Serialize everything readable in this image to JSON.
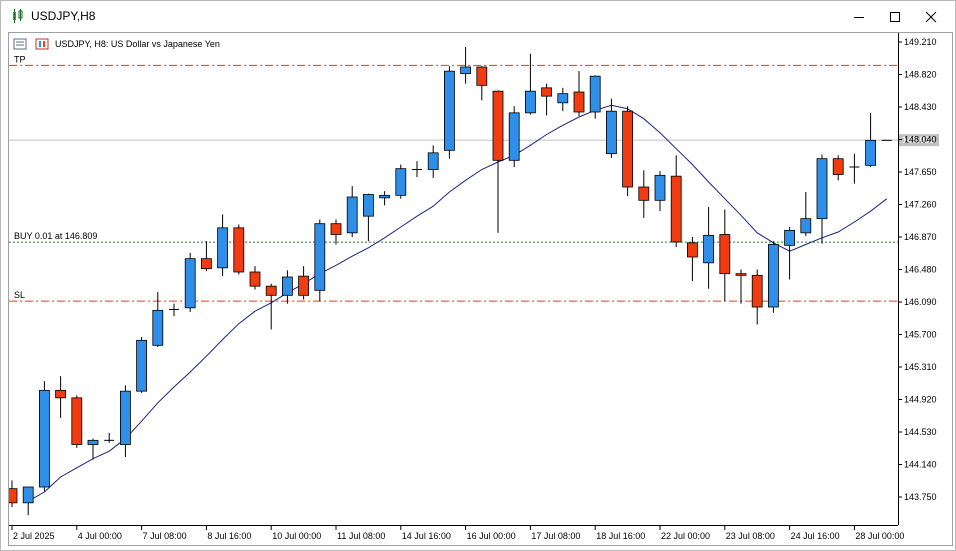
{
  "window": {
    "title": "USDJPY,H8"
  },
  "chart_header": {
    "symbol_label": "USDJPY, H8:  US Dollar vs Japanese Yen"
  },
  "colors": {
    "bull": "#2f8fe8",
    "bear": "#f03c10",
    "wick": "#000000",
    "ma": "#1a237e",
    "sltp_line": "#f03c10",
    "order_line": "#2e7d32",
    "price_line": "#c0c0c0",
    "grid": "#ffffff"
  },
  "chart_data": {
    "type": "candlestick",
    "symbol": "USDJPY",
    "timeframe": "H8",
    "ylim": [
      143.3,
      149.4
    ],
    "y_ticks": [
      "149.210",
      "148.820",
      "148.430",
      "148.040",
      "147.650",
      "147.260",
      "146.870",
      "146.480",
      "146.090",
      "145.700",
      "145.310",
      "144.920",
      "144.530",
      "144.140",
      "143.750"
    ],
    "x_ticks": [
      {
        "index": 0,
        "label": "2 Jul 2025"
      },
      {
        "index": 4,
        "label": "4 Jul 00:00"
      },
      {
        "index": 8,
        "label": "7 Jul 08:00"
      },
      {
        "index": 12,
        "label": "8 Jul 16:00"
      },
      {
        "index": 16,
        "label": "10 Jul 00:00"
      },
      {
        "index": 20,
        "label": "11 Jul 08:00"
      },
      {
        "index": 24,
        "label": "14 Jul 16:00"
      },
      {
        "index": 28,
        "label": "16 Jul 00:00"
      },
      {
        "index": 32,
        "label": "17 Jul 08:00"
      },
      {
        "index": 36,
        "label": "18 Jul 16:00"
      },
      {
        "index": 40,
        "label": "22 Jul 00:00"
      },
      {
        "index": 44,
        "label": "23 Jul 08:00"
      },
      {
        "index": 48,
        "label": "24 Jul 16:00"
      },
      {
        "index": 52,
        "label": "28 Jul 00:00"
      }
    ],
    "candles": [
      {
        "o": 143.85,
        "h": 143.95,
        "l": 143.63,
        "c": 143.68
      },
      {
        "o": 143.68,
        "h": 143.87,
        "l": 143.53,
        "c": 143.87
      },
      {
        "o": 143.87,
        "h": 145.14,
        "l": 143.82,
        "c": 145.03
      },
      {
        "o": 145.03,
        "h": 145.2,
        "l": 144.7,
        "c": 144.94
      },
      {
        "o": 144.94,
        "h": 144.97,
        "l": 144.34,
        "c": 144.38
      },
      {
        "o": 144.38,
        "h": 144.45,
        "l": 144.2,
        "c": 144.43
      },
      {
        "o": 144.43,
        "h": 144.52,
        "l": 144.4,
        "c": 144.43
      },
      {
        "o": 144.38,
        "h": 145.09,
        "l": 144.23,
        "c": 145.02
      },
      {
        "o": 145.02,
        "h": 145.67,
        "l": 145.0,
        "c": 145.63
      },
      {
        "o": 145.57,
        "h": 146.21,
        "l": 145.55,
        "c": 145.99
      },
      {
        "o": 145.99,
        "h": 146.07,
        "l": 145.92,
        "c": 146.0
      },
      {
        "o": 146.02,
        "h": 146.68,
        "l": 145.97,
        "c": 146.61
      },
      {
        "o": 146.61,
        "h": 146.82,
        "l": 146.46,
        "c": 146.49
      },
      {
        "o": 146.5,
        "h": 147.14,
        "l": 146.4,
        "c": 146.98
      },
      {
        "o": 146.98,
        "h": 147.02,
        "l": 146.42,
        "c": 146.45
      },
      {
        "o": 146.45,
        "h": 146.52,
        "l": 146.24,
        "c": 146.28
      },
      {
        "o": 146.28,
        "h": 146.31,
        "l": 145.76,
        "c": 146.17
      },
      {
        "o": 146.17,
        "h": 146.47,
        "l": 146.07,
        "c": 146.39
      },
      {
        "o": 146.4,
        "h": 146.52,
        "l": 146.12,
        "c": 146.17
      },
      {
        "o": 146.23,
        "h": 147.08,
        "l": 146.1,
        "c": 147.03
      },
      {
        "o": 147.03,
        "h": 147.08,
        "l": 146.78,
        "c": 146.9
      },
      {
        "o": 146.92,
        "h": 147.48,
        "l": 146.87,
        "c": 147.35
      },
      {
        "o": 147.12,
        "h": 147.39,
        "l": 146.82,
        "c": 147.38
      },
      {
        "o": 147.34,
        "h": 147.42,
        "l": 147.25,
        "c": 147.37
      },
      {
        "o": 147.37,
        "h": 147.74,
        "l": 147.33,
        "c": 147.69
      },
      {
        "o": 147.68,
        "h": 147.78,
        "l": 147.59,
        "c": 147.68
      },
      {
        "o": 147.68,
        "h": 147.97,
        "l": 147.58,
        "c": 147.88
      },
      {
        "o": 147.91,
        "h": 148.92,
        "l": 147.81,
        "c": 148.86
      },
      {
        "o": 148.83,
        "h": 149.15,
        "l": 148.71,
        "c": 148.91
      },
      {
        "o": 148.91,
        "h": 148.92,
        "l": 148.51,
        "c": 148.69
      },
      {
        "o": 148.62,
        "h": 148.63,
        "l": 146.92,
        "c": 147.79
      },
      {
        "o": 147.79,
        "h": 148.44,
        "l": 147.71,
        "c": 148.36
      },
      {
        "o": 148.36,
        "h": 149.07,
        "l": 148.34,
        "c": 148.62
      },
      {
        "o": 148.66,
        "h": 148.71,
        "l": 148.33,
        "c": 148.56
      },
      {
        "o": 148.48,
        "h": 148.66,
        "l": 148.38,
        "c": 148.59
      },
      {
        "o": 148.61,
        "h": 148.86,
        "l": 148.32,
        "c": 148.37
      },
      {
        "o": 148.37,
        "h": 148.81,
        "l": 148.29,
        "c": 148.8
      },
      {
        "o": 147.87,
        "h": 148.53,
        "l": 147.82,
        "c": 148.38
      },
      {
        "o": 148.38,
        "h": 148.44,
        "l": 147.36,
        "c": 147.47
      },
      {
        "o": 147.47,
        "h": 147.67,
        "l": 147.1,
        "c": 147.31
      },
      {
        "o": 147.31,
        "h": 147.66,
        "l": 147.18,
        "c": 147.61
      },
      {
        "o": 147.6,
        "h": 147.85,
        "l": 146.75,
        "c": 146.81
      },
      {
        "o": 146.8,
        "h": 146.87,
        "l": 146.34,
        "c": 146.63
      },
      {
        "o": 146.56,
        "h": 147.23,
        "l": 146.25,
        "c": 146.89
      },
      {
        "o": 146.9,
        "h": 147.2,
        "l": 146.1,
        "c": 146.43
      },
      {
        "o": 146.43,
        "h": 146.48,
        "l": 146.07,
        "c": 146.41
      },
      {
        "o": 146.41,
        "h": 146.48,
        "l": 145.82,
        "c": 146.03
      },
      {
        "o": 146.03,
        "h": 146.82,
        "l": 145.96,
        "c": 146.78
      },
      {
        "o": 146.77,
        "h": 146.99,
        "l": 146.36,
        "c": 146.95
      },
      {
        "o": 146.92,
        "h": 147.41,
        "l": 146.88,
        "c": 147.09
      },
      {
        "o": 147.09,
        "h": 147.86,
        "l": 146.79,
        "c": 147.81
      },
      {
        "o": 147.81,
        "h": 147.85,
        "l": 147.55,
        "c": 147.62
      },
      {
        "o": 147.71,
        "h": 147.87,
        "l": 147.51,
        "c": 147.71
      },
      {
        "o": 147.73,
        "h": 148.36,
        "l": 147.71,
        "c": 148.03
      },
      {
        "o": 148.03,
        "h": 148.03,
        "l": 148.03,
        "c": 148.03
      }
    ],
    "moving_average": [
      null,
      143.7,
      143.81,
      143.99,
      144.1,
      144.21,
      144.3,
      144.45,
      144.66,
      144.88,
      145.07,
      145.25,
      145.44,
      145.64,
      145.83,
      145.98,
      146.08,
      146.2,
      146.31,
      146.43,
      146.53,
      146.64,
      146.74,
      146.86,
      146.99,
      147.12,
      147.24,
      147.41,
      147.55,
      147.68,
      147.77,
      147.85,
      147.97,
      148.1,
      148.21,
      148.31,
      148.39,
      148.45,
      148.41,
      148.29,
      148.12,
      147.93,
      147.74,
      147.53,
      147.33,
      147.13,
      146.92,
      146.8,
      146.7,
      146.78,
      146.86,
      146.93,
      147.05,
      147.18,
      147.33
    ],
    "current_price": 148.032,
    "current_price_label": "148.032",
    "levels": [
      {
        "name": "TP",
        "label": "TP",
        "price": 148.93
      },
      {
        "name": "BUY",
        "label": "BUY 0.01 at 146.809",
        "price": 146.809
      },
      {
        "name": "SL",
        "label": "SL",
        "price": 146.1
      }
    ]
  }
}
